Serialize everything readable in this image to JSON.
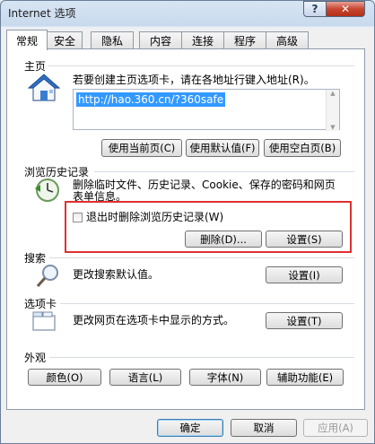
{
  "window": {
    "title": "Internet 选项",
    "help_label": "?",
    "close_label": "✕"
  },
  "tabs": [
    {
      "label": "常规",
      "active": true
    },
    {
      "label": "安全"
    },
    {
      "label": "隐私"
    },
    {
      "label": "内容"
    },
    {
      "label": "连接"
    },
    {
      "label": "程序"
    },
    {
      "label": "高级"
    }
  ],
  "home": {
    "label": "主页",
    "description": "若要创建主页选项卡，请在各地址行键入地址(R)。",
    "url": "http://hao.360.cn/?360safe",
    "buttons": {
      "use_current": "使用当前页(C)",
      "use_default": "使用默认值(F)",
      "use_blank": "使用空白页(B)"
    }
  },
  "history": {
    "label": "浏览历史记录",
    "description_line1": "删除临时文件、历史记录、Cookie、保存的密码和网页",
    "description_line2": "表单信息。",
    "checkbox_label": "退出时删除浏览历史记录(W)",
    "checkbox_checked": false,
    "delete_button": "删除(D)...",
    "settings_button": "设置(S)"
  },
  "search": {
    "label": "搜索",
    "description": "更改搜索默认值。",
    "settings_button": "设置(I)"
  },
  "tabs_section": {
    "label": "选项卡",
    "description": "更改网页在选项卡中显示的方式。",
    "settings_button": "设置(T)"
  },
  "appearance": {
    "label": "外观",
    "buttons": {
      "colors": "颜色(O)",
      "languages": "语言(L)",
      "fonts": "字体(N)",
      "accessibility": "辅助功能(E)"
    }
  },
  "footer": {
    "ok": "确定",
    "cancel": "取消",
    "apply": "应用(A)"
  }
}
